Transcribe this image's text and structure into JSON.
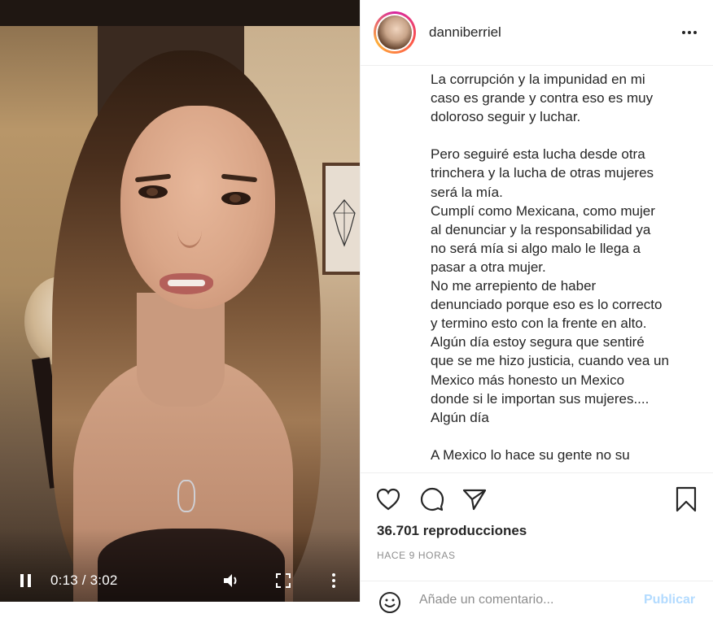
{
  "video": {
    "time_display": "0:13 / 3:02",
    "icons": {
      "pause": "pause-icon",
      "volume": "volume-icon",
      "fullscreen": "fullscreen-icon",
      "more": "more-vertical-icon"
    }
  },
  "post": {
    "username": "danniberriel",
    "caption_lines": [
      "La corrupción y la impunidad en mi",
      "caso es grande y contra eso es muy",
      "doloroso seguir y luchar.",
      "",
      "Pero seguiré esta lucha desde otra",
      "trinchera y la lucha de otras mujeres",
      "será la mía.",
      "Cumplí como Mexicana, como mujer",
      "al denunciar y la responsabilidad ya",
      "no será mía si algo malo le llega a",
      "pasar a otra mujer.",
      "No me arrepiento de haber",
      "denunciado porque eso es lo correcto",
      "y termino esto con la frente en alto.",
      "Algún día estoy segura que sentiré",
      "que se me hizo justicia, cuando vea un",
      "Mexico más honesto un Mexico",
      "donde si le importan sus mujeres....",
      "Algún día",
      "",
      "A Mexico lo hace su gente no su"
    ],
    "views": "36.701 reproducciones",
    "time_ago": "HACE 9 HORAS",
    "comment_placeholder": "Añade un comentario...",
    "post_label": "Publicar"
  },
  "colors": {
    "text": "#262626",
    "muted": "#8e8e8e",
    "post_disabled": "#b3dbff"
  }
}
